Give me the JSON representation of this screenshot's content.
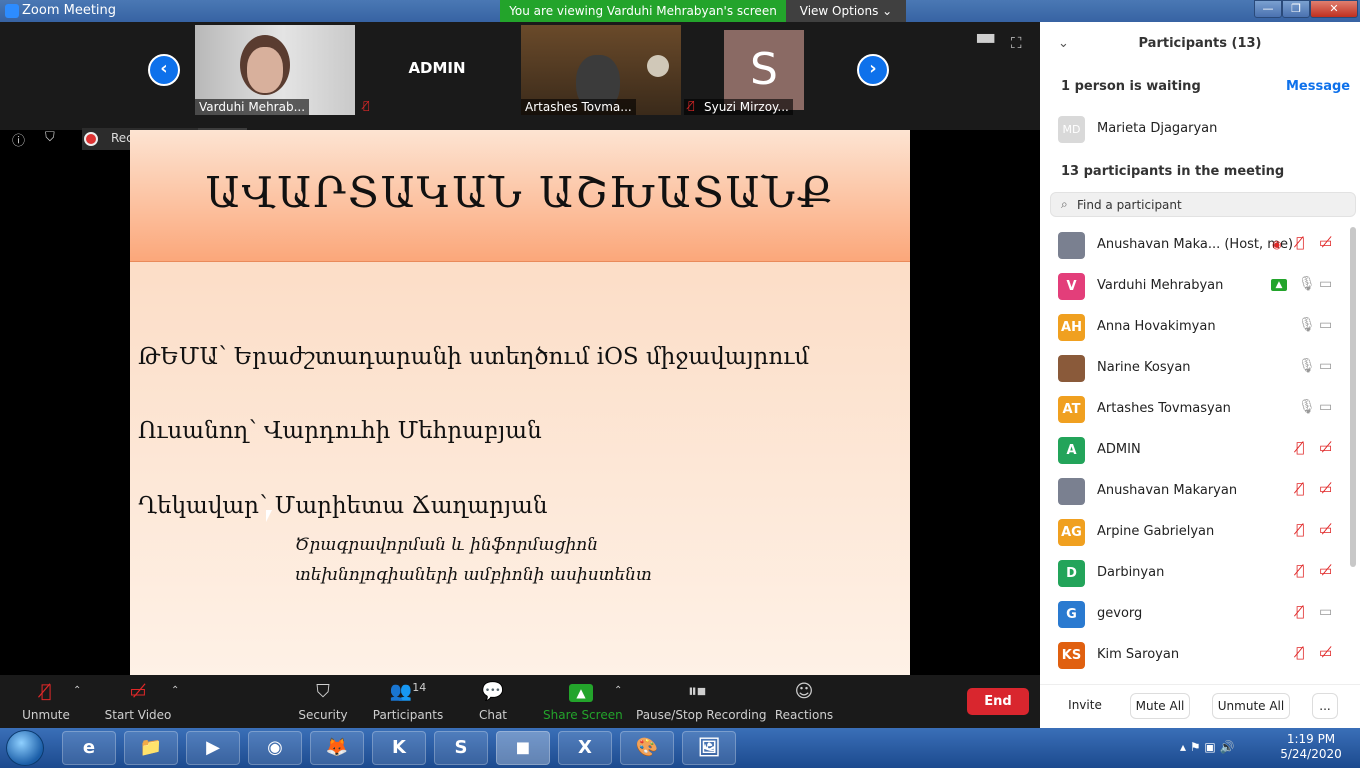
{
  "window": {
    "title": "Zoom Meeting",
    "banner": "You are viewing Varduhi Mehrabyan's screen",
    "view_options": "View Options ⌄",
    "minimize": "—",
    "restore": "❐",
    "close": "✕"
  },
  "gallery": {
    "prev": "‹",
    "next": "›",
    "tiles": [
      {
        "name": "Varduhi Mehrab...",
        "type": "video1",
        "muted": false
      },
      {
        "name": "ADMIN",
        "type": "name",
        "muted": true
      },
      {
        "name": "Artashes Tovma...",
        "type": "video2",
        "muted": false
      },
      {
        "name": "Syuzi Mirzoy...",
        "type": "avatar",
        "initial": "S",
        "muted": true
      }
    ]
  },
  "recording": {
    "label": "Recording...",
    "pause": "❚❚",
    "stop": "■"
  },
  "slide": {
    "title": "ԱՎԱՐՏԱԿԱՆ ԱՇԽԱՏԱՆՔ",
    "topic": "ԹԵՄԱ՝    Երաժշտադարանի ստեղծում iOS միջավայրում",
    "student": "Ուսանող՝   Վարդուհի Մեհրաբյան",
    "supervisor": "Ղեկավար՝  Մարիետա Ճաղարյան",
    "sub1": "Ծրագրավորման և ինֆորմացիոն",
    "sub2": "տեխնոլոգիաների ամբիոնի ասիստենտ"
  },
  "panel": {
    "title": "Participants (13)",
    "collapse": "⌄",
    "waiting_header": "1 person is waiting",
    "message_link": "Message",
    "waiting": {
      "initials": "MD",
      "name": "Marieta Djagaryan",
      "color": "#d9d9d9"
    },
    "meeting_header": "13 participants in the meeting",
    "search_placeholder": "Find a participant",
    "participants": [
      {
        "initials": "",
        "name": "Anushavan Maka... (Host, me)",
        "color": "#7a8090",
        "photo": true,
        "rec": true,
        "mic": "muted",
        "cam": "off"
      },
      {
        "initials": "V",
        "name": "Varduhi Mehrabyan",
        "color": "#e33e7a",
        "share": true,
        "mic": "on",
        "cam": "on"
      },
      {
        "initials": "AH",
        "name": "Anna Hovakimyan",
        "color": "#f0a020",
        "mic": "on",
        "cam": "on"
      },
      {
        "initials": "",
        "name": "Narine Kosyan",
        "color": "#8a5a3a",
        "photo": true,
        "mic": "on",
        "cam": "on"
      },
      {
        "initials": "AT",
        "name": "Artashes Tovmasyan",
        "color": "#f0a020",
        "mic": "on",
        "cam": "on"
      },
      {
        "initials": "A",
        "name": "ADMIN",
        "color": "#23a45a",
        "mic": "muted",
        "cam": "off"
      },
      {
        "initials": "",
        "name": "Anushavan Makaryan",
        "color": "#7a8090",
        "photo": true,
        "mic": "muted",
        "cam": "off"
      },
      {
        "initials": "AG",
        "name": "Arpine Gabrielyan",
        "color": "#f0a020",
        "mic": "muted",
        "cam": "off"
      },
      {
        "initials": "D",
        "name": "Darbinyan",
        "color": "#23a45a",
        "mic": "muted",
        "cam": "off"
      },
      {
        "initials": "G",
        "name": "gevorg",
        "color": "#2a7ad0",
        "mic": "muted",
        "cam": "on"
      },
      {
        "initials": "KS",
        "name": "Kim Saroyan",
        "color": "#e06010",
        "mic": "muted",
        "cam": "off"
      }
    ],
    "buttons": {
      "invite": "Invite",
      "mute_all": "Mute All",
      "unmute_all": "Unmute All",
      "more": "..."
    }
  },
  "toolbar": {
    "unmute": "Unmute",
    "start_video": "Start Video",
    "security": "Security",
    "participants": "Participants",
    "participants_count": "14",
    "chat": "Chat",
    "share_screen": "Share Screen",
    "recording": "Pause/Stop Recording",
    "reactions": "Reactions",
    "end": "End"
  },
  "taskbar": {
    "apps": [
      "e",
      "📁",
      "▶",
      "◉",
      "🦊",
      "K",
      "S",
      "◼",
      "X",
      "🎨",
      "🖼"
    ],
    "time": "1:19 PM",
    "date": "5/24/2020"
  },
  "colors": {
    "accent": "#0e71eb",
    "end": "#d9262e",
    "banner": "#23a42b",
    "muted": "#e02828",
    "share": "#23a42b"
  }
}
